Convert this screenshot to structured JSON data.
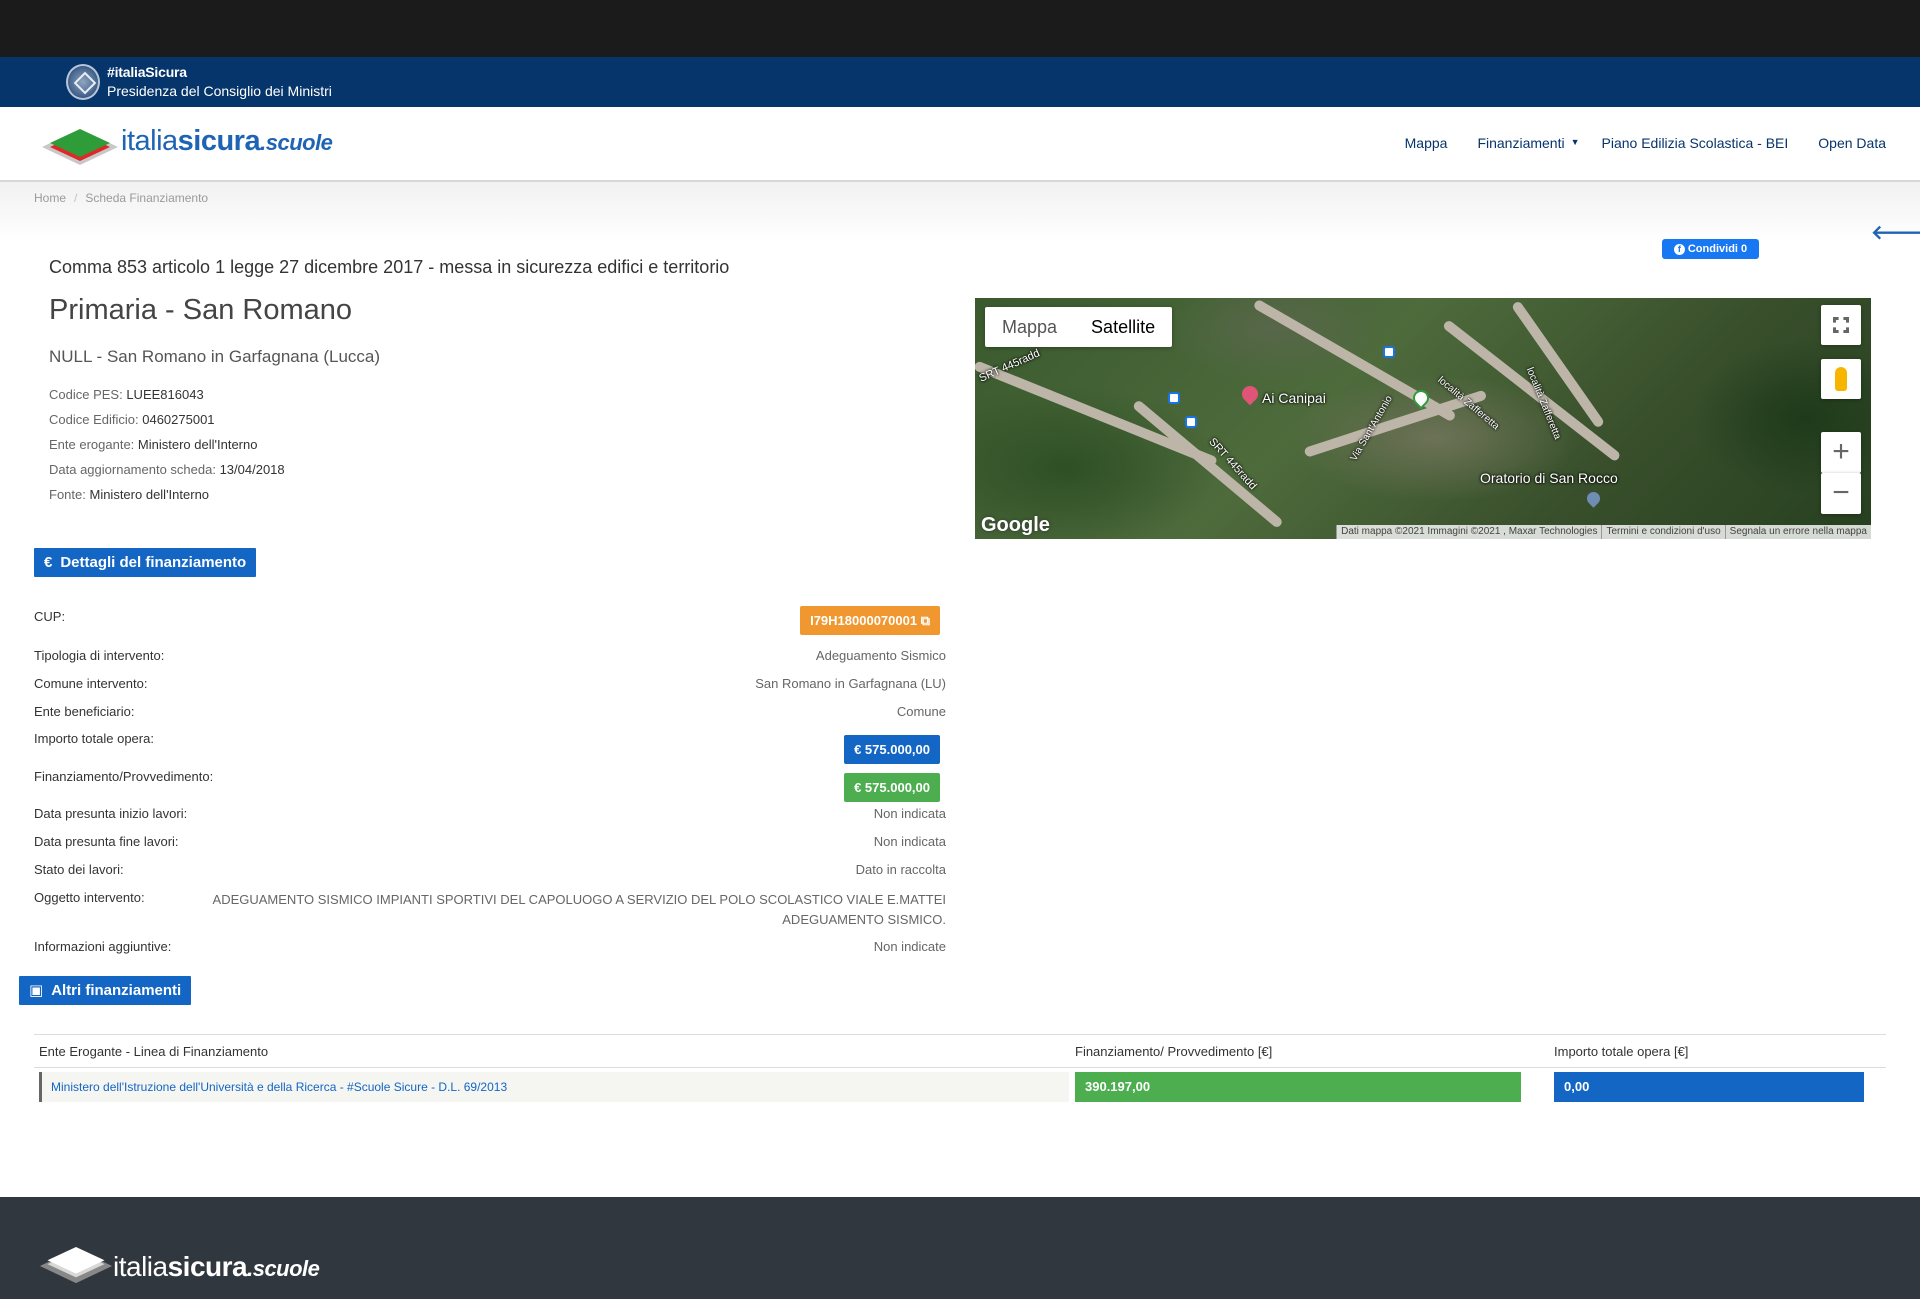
{
  "gov": {
    "tag": "#italiaSicura",
    "name": "Presidenza del Consiglio dei Ministri"
  },
  "brand": {
    "part1": "italia",
    "part2": "sicura",
    "part3": ".scuole"
  },
  "nav": {
    "items": [
      "Mappa",
      "Finanziamenti",
      "Piano Edilizia Scolastica - BEI",
      "Open Data"
    ]
  },
  "breadcrumb": {
    "home": "Home",
    "sep": "/",
    "current": "Scheda Finanziamento"
  },
  "share": {
    "label": "Condividi 0",
    "fb": "f"
  },
  "back": "🡐",
  "header": {
    "law": "Comma 853 articolo 1 legge 27 dicembre 2017 - messa in sicurezza edifici e territorio",
    "school": "Primaria - San Romano",
    "place": "NULL - San Romano in Garfagnana (Lucca)"
  },
  "meta": [
    {
      "label": "Codice PES:",
      "value": "LUEE816043"
    },
    {
      "label": "Codice Edificio:",
      "value": "0460275001"
    },
    {
      "label": "Ente erogante:",
      "value": "Ministero dell'Interno"
    },
    {
      "label": "Data aggiornamento scheda:",
      "value": "13/04/2018"
    },
    {
      "label": "Fonte:",
      "value": "Ministero dell'Interno"
    }
  ],
  "map": {
    "type_map": "Mappa",
    "type_satellite": "Satellite",
    "labels": [
      "Ai Canipai",
      "Oratorio di San Rocco",
      "SRT 445radd",
      "SRT 445radd",
      "Via Sant'Antonio",
      "località Zafferetta",
      "località Zafferetta"
    ],
    "google": "Google",
    "attribution": [
      "Dati mappa ©2021 Immagini ©2021 , Maxar Technologies",
      "Termini e condizioni d'uso",
      "Segnala un errore nella mappa"
    ],
    "zoom_in": "+",
    "zoom_out": "−"
  },
  "details": {
    "button": "Dettagli del finanziamento",
    "icon": "€",
    "rows": [
      {
        "label": "CUP:",
        "value": "I79H18000070001"
      },
      {
        "label": "Tipologia di intervento:",
        "value": "Adeguamento Sismico"
      },
      {
        "label": "Comune intervento:",
        "value": "San Romano in Garfagnana (LU)"
      },
      {
        "label": "Ente beneficiario:",
        "value": "Comune"
      },
      {
        "label": "Importo totale opera:",
        "value": "€ 575.000,00"
      },
      {
        "label": "Finanziamento/Provvedimento:",
        "value": "€ 575.000,00"
      },
      {
        "label": "Data presunta inizio lavori:",
        "value": "Non indicata"
      },
      {
        "label": "Data presunta fine lavori:",
        "value": "Non indicata"
      },
      {
        "label": "Stato dei lavori:",
        "value": "Dato in raccolta"
      },
      {
        "label": "Oggetto intervento:",
        "value": "ADEGUAMENTO SISMICO IMPIANTI SPORTIVI DEL CAPOLUOGO A SERVIZIO DEL POLO SCOLASTICO VIALE E.MATTEI ADEGUAMENTO SISMICO."
      },
      {
        "label": "Informazioni aggiuntive:",
        "value": "Non indicate"
      }
    ]
  },
  "altri": {
    "button": "Altri finanziamenti",
    "columns": [
      "Ente Erogante - Linea di Finanziamento",
      "Finanziamento/ Provvedimento [€]",
      "Importo totale opera [€]"
    ],
    "rows": [
      {
        "ente": "Ministero dell'Istruzione dell'Università e della Ricerca - #Scuole Sicure - D.L. 69/2013",
        "finanziamento": "390.197,00",
        "importo": "0,00"
      }
    ]
  },
  "colors": {
    "gov_blue": "#06356b",
    "brand_blue": "#1f64b4",
    "button_blue": "#1466c5",
    "green": "#4cae4f",
    "orange": "#f0972f",
    "footer": "#30373e"
  }
}
